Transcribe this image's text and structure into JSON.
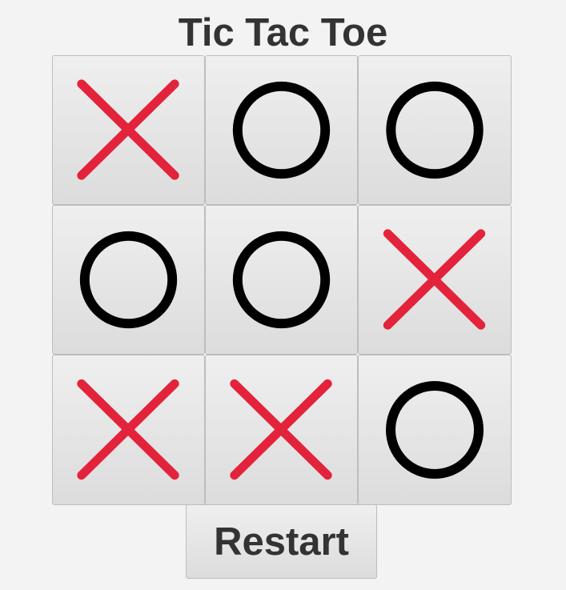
{
  "title": "Tic Tac Toe",
  "board": {
    "cells": [
      "X",
      "O",
      "O",
      "O",
      "O",
      "X",
      "X",
      "X",
      "O"
    ]
  },
  "controls": {
    "restart_label": "Restart"
  },
  "colors": {
    "x_mark": "#e3233b",
    "o_mark": "#000000",
    "text": "#333333"
  },
  "icons": {
    "X": "cross-mark-icon",
    "O": "circle-mark-icon"
  }
}
